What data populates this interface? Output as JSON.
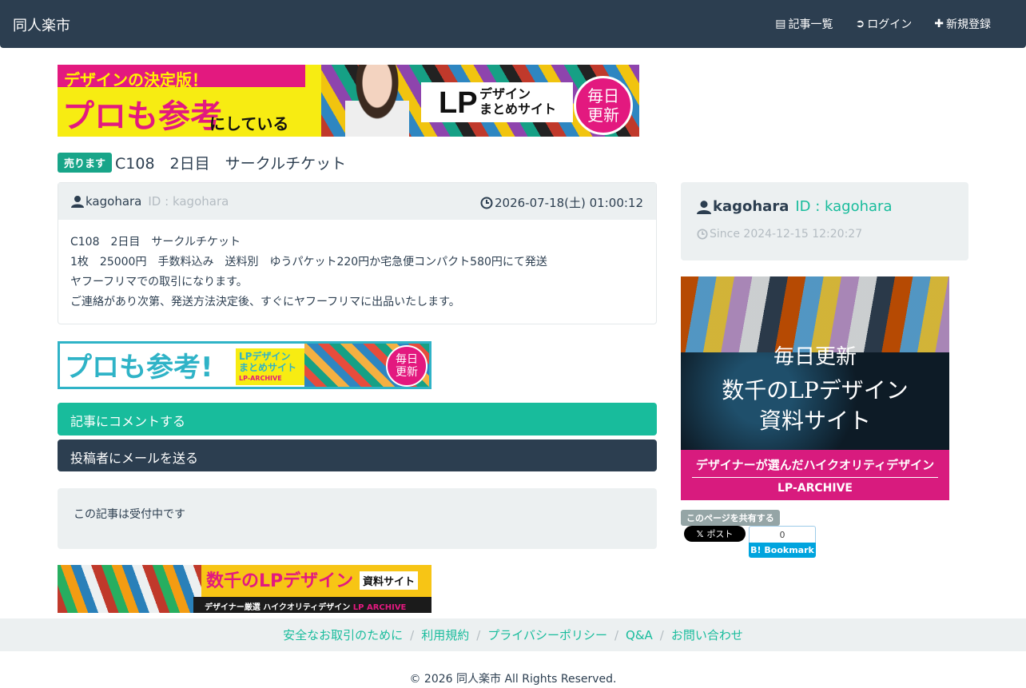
{
  "header": {
    "brand": "同人楽市",
    "nav": [
      {
        "icon": "list-icon",
        "label": "記事一覧"
      },
      {
        "icon": "sign-in-icon",
        "label": "ログイン"
      },
      {
        "icon": "plus-icon",
        "label": "新規登録"
      }
    ]
  },
  "banner_top": {
    "line1": "デザインの決定版！",
    "line2": "プロも参考",
    "line3": "にしている",
    "logo": "LP",
    "logo_sub": "デザイン\nまとめサイト",
    "circle": "毎日\n更新"
  },
  "post": {
    "badge": "売ります",
    "title": "C108　2日目　サークルチケット",
    "username": "kagohara",
    "user_id": "ID : kagohara",
    "datetime": "2026-07-18(土) 01:00:12",
    "body_lines": [
      "C108　2日目　サークルチケット",
      "1枚　25000円　手数料込み　送料別　ゆうパケット220円か宅急便コンパクト580円にて発送",
      "ヤフーフリマでの取引になります。",
      "ご連絡があり次第、発送方法決定後、すぐにヤフーフリマに出品いたします。"
    ]
  },
  "banner_mid": {
    "text": "プロも参考!",
    "sub1": "LPデザイン",
    "sub2": "まとめサイト",
    "sub3": "LP-ARCHIVE",
    "circle": "毎日\n更新"
  },
  "actions": {
    "comment": "記事にコメントする",
    "mail": "投稿者にメールを送る"
  },
  "status": "この記事は受付中です",
  "banner_bottom": {
    "title": "数千のLPデザイン",
    "tag": "資料サイト",
    "strip": "デザイナー厳選 ハイクオリティデザイン",
    "strip_logo": "LP ARCHIVE"
  },
  "profile": {
    "username": "kagohara",
    "user_id": "ID : kagohara",
    "since": "Since 2024-12-15 12:20:27"
  },
  "banner_side": {
    "daily": "毎日更新",
    "main1": "数千のLPデザイン",
    "main2": "資料サイト",
    "tagline": "デザイナーが選んだハイクオリティデザイン",
    "logo": "LP-ARCHIVE"
  },
  "share": {
    "label": "このページを共有する",
    "x_post": "ポスト",
    "hatena_count": "0",
    "hatena_label": "B! Bookmark"
  },
  "footer": {
    "links": [
      "安全なお取引のために",
      "利用規約",
      "プライバシーポリシー",
      "Q&A",
      "お問い合わせ"
    ],
    "copyright": "© 2026 同人楽市 All Rights Reserved."
  },
  "colors": {
    "navbar": "#2c3e50",
    "accent": "#18bc9c",
    "badge": "#18a589",
    "well": "#ecf0f1"
  }
}
